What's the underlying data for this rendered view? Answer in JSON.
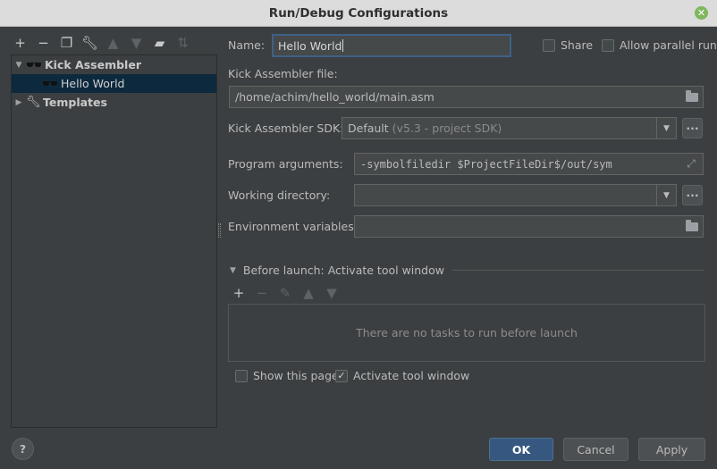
{
  "window": {
    "title": "Run/Debug Configurations"
  },
  "left_toolbar": {
    "icons": [
      "add-icon",
      "remove-icon",
      "copy-icon",
      "wrench-icon",
      "move-up-icon",
      "move-down-icon",
      "folder-add-icon",
      "sort-icon"
    ],
    "add_symbol": "+",
    "remove_symbol": "−"
  },
  "tree": {
    "items": [
      {
        "label": "Kick Assembler",
        "expanded": true,
        "level": 0
      },
      {
        "label": "Hello World",
        "selected": true,
        "level": 1
      },
      {
        "label": "Templates",
        "expanded": false,
        "level": 0
      }
    ]
  },
  "form": {
    "name_label": "Name:",
    "name_value": "Hello World",
    "share_label": "Share",
    "share_checked": false,
    "allow_parallel_label": "Allow parallel run",
    "allow_parallel_checked": false,
    "file_label": "Kick Assembler file:",
    "file_value": "/home/achim/hello_world/main.asm",
    "sdk_label": "Kick Assembler SDK:",
    "sdk_value": "Default",
    "sdk_detail": "(v5.3 - project SDK)",
    "program_args_label": "Program arguments:",
    "program_args_value": "-symbolfiledir $ProjectFileDir$/out/sym",
    "working_dir_label": "Working directory:",
    "working_dir_value": "",
    "env_vars_label": "Environment variables:",
    "env_vars_value": "",
    "browse_label": "..."
  },
  "before_launch": {
    "header": "Before launch: Activate tool window",
    "empty_text": "There are no tasks to run before launch",
    "add_symbol": "+",
    "remove_symbol": "−"
  },
  "options": {
    "show_page_label": "Show this page",
    "show_page_checked": false,
    "activate_tool_label": "Activate tool window",
    "activate_tool_checked": true
  },
  "buttons": {
    "help": "?",
    "ok": "OK",
    "cancel": "Cancel",
    "apply": "Apply"
  },
  "colors": {
    "background": "#3c3f41",
    "selection": "#0d293e",
    "primary_button": "#365880",
    "focus_border": "#3d6185"
  }
}
